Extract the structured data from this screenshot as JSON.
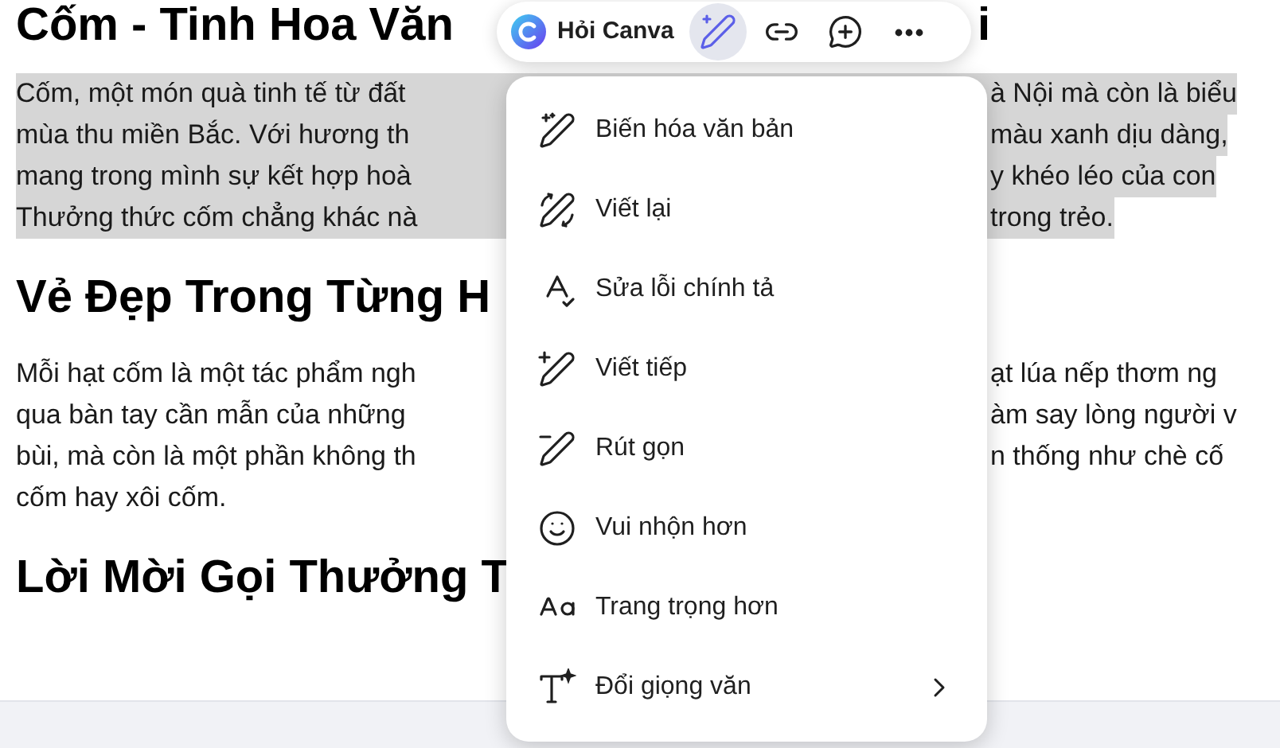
{
  "document": {
    "blocks": [
      {
        "kind": "heading",
        "left": "Cốm - Tinh Hoa Văn",
        "right": "i"
      },
      {
        "kind": "paragraph",
        "highlighted": true,
        "lines": [
          {
            "left": "Cốm, một món quà tinh tế từ đất",
            "right": "à Nội mà còn là biểu"
          },
          {
            "left": "mùa thu miền Bắc. Với hương th",
            "right": "màu xanh dịu dàng,"
          },
          {
            "left": "mang trong mình sự kết hợp hoà",
            "right": "y khéo léo của con"
          },
          {
            "left": "Thưởng thức cốm chẳng khác nà",
            "right": "trong trẻo."
          }
        ]
      },
      {
        "kind": "heading",
        "left": "Vẻ Đẹp Trong Từng H"
      },
      {
        "kind": "paragraph",
        "highlighted": false,
        "lines": [
          {
            "left": "Mỗi hạt cốm là một tác phẩm ngh",
            "right": "ạt lúa nếp thơm ng"
          },
          {
            "left": "qua bàn tay cần mẫn của những",
            "right": "àm say lòng người v"
          },
          {
            "left": "bùi, mà còn là một phần không th",
            "right": "n thống như chè cố"
          },
          {
            "left": "cốm hay xôi cốm."
          }
        ]
      },
      {
        "kind": "heading",
        "left": "Lời Mời Gọi Thưởng T"
      }
    ]
  },
  "toolbar": {
    "brand": "Hỏi Canva",
    "tools": [
      {
        "kind": "magic",
        "selected": true
      },
      {
        "kind": "link",
        "selected": false
      },
      {
        "kind": "comment",
        "selected": false
      },
      {
        "kind": "more",
        "selected": false
      }
    ]
  },
  "menu": {
    "items": [
      {
        "kind": "transform",
        "label": "Biến hóa văn bản",
        "submenu": false
      },
      {
        "kind": "rewrite",
        "label": "Viết lại",
        "submenu": false
      },
      {
        "kind": "spelling",
        "label": "Sửa lỗi chính tả",
        "submenu": false
      },
      {
        "kind": "continue",
        "label": "Viết tiếp",
        "submenu": false
      },
      {
        "kind": "shorten",
        "label": "Rút gọn",
        "submenu": false
      },
      {
        "kind": "fun",
        "label": "Vui nhộn hơn",
        "submenu": false
      },
      {
        "kind": "formal",
        "label": "Trang trọng hơn",
        "submenu": false
      },
      {
        "kind": "tone",
        "label": "Đổi giọng văn",
        "submenu": true
      }
    ]
  }
}
